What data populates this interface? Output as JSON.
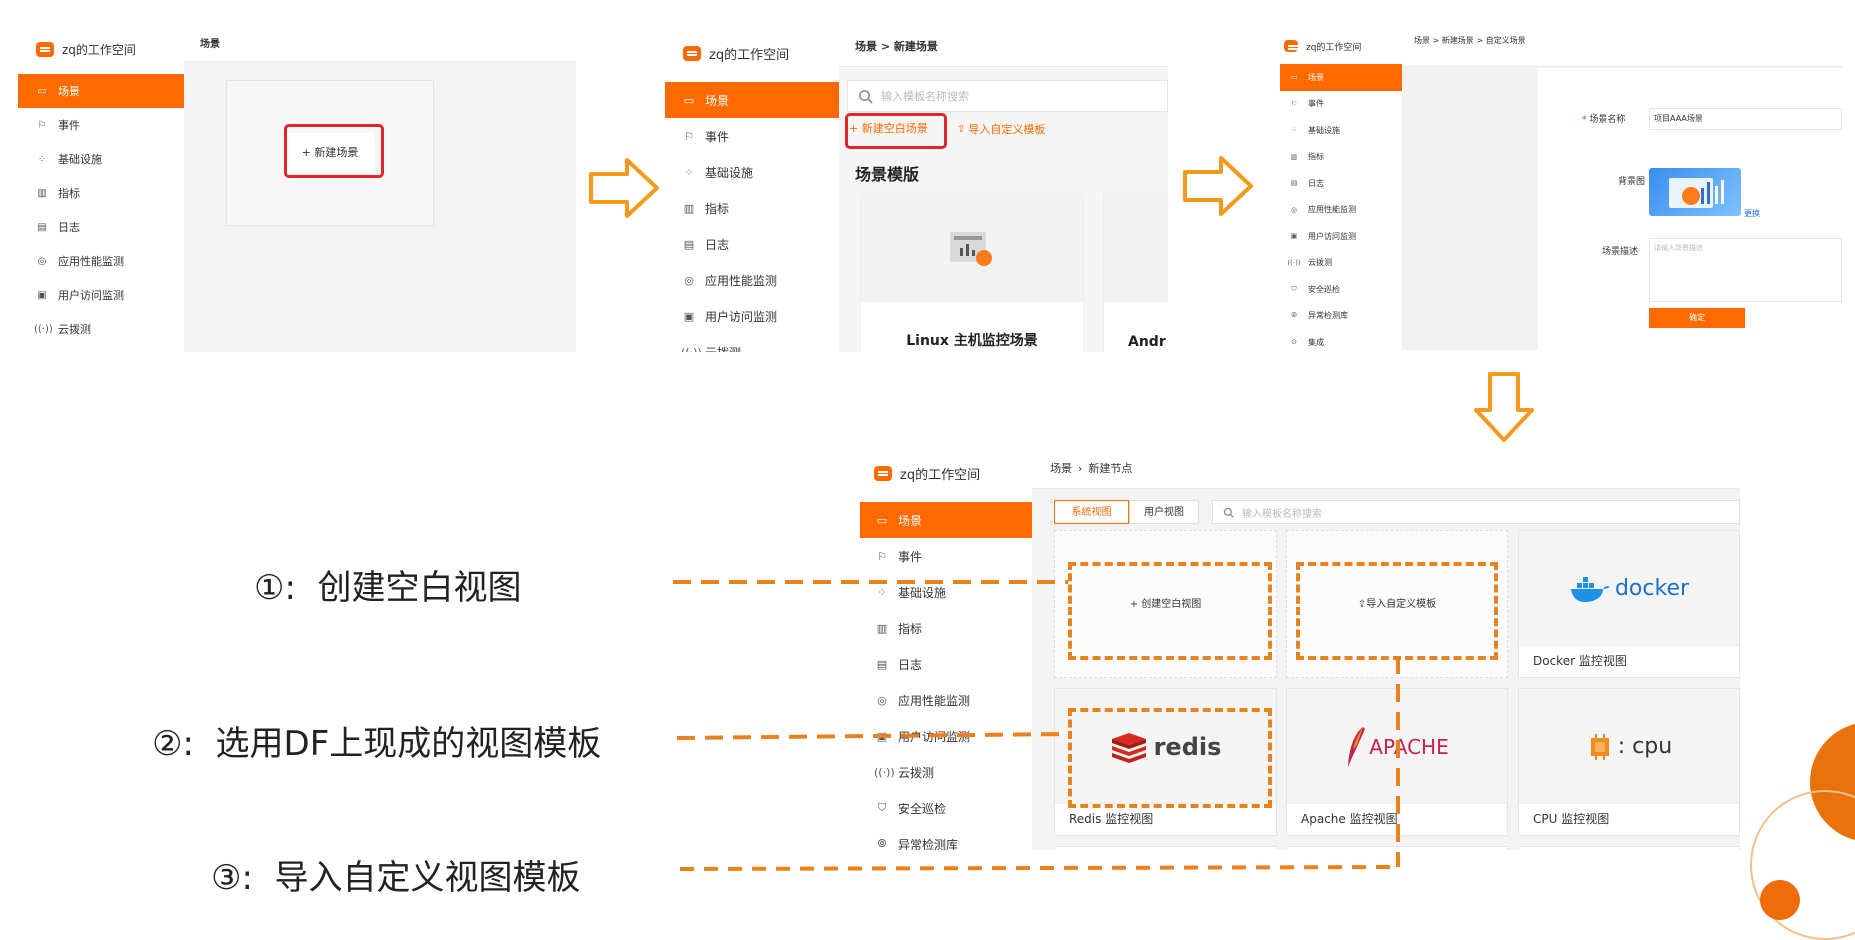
{
  "workspace_name": "zq的工作空间",
  "nav_items": [
    {
      "label": "场景",
      "icon": "dashboard-icon"
    },
    {
      "label": "事件",
      "icon": "flag-icon"
    },
    {
      "label": "基础设施",
      "icon": "grid-icon"
    },
    {
      "label": "指标",
      "icon": "bar-chart-icon"
    },
    {
      "label": "日志",
      "icon": "calendar-icon"
    },
    {
      "label": "应用性能监测",
      "icon": "target-icon"
    },
    {
      "label": "用户访问监测",
      "icon": "monitor-icon"
    },
    {
      "label": "云拨测",
      "icon": "signal-icon"
    },
    {
      "label": "安全巡检",
      "icon": "shield-icon"
    },
    {
      "label": "异常检测库",
      "icon": "detector-icon"
    },
    {
      "label": "集成",
      "icon": "integration-icon"
    }
  ],
  "panel1": {
    "breadcrumb": "场景",
    "new_scene_button": "+ 新建场景"
  },
  "panel2": {
    "breadcrumb": "场景 > 新建场景",
    "search_placeholder": "输入模板名称搜索",
    "new_blank_scene": "+ 新建空白场景",
    "import_template": "导入自定义模板",
    "section_title": "场景模版",
    "card1_title": "Linux 主机监控场景",
    "card2_title_partial": "Andr"
  },
  "panel3": {
    "breadcrumb": "场景 > 新建场景 > 自定义场景",
    "name_label": "场景名称",
    "name_value": "项目AAA场景",
    "bg_label": "背景图",
    "change_link": "更换",
    "desc_label": "场景描述",
    "desc_placeholder": "请输入场景描述",
    "confirm_button": "确定"
  },
  "panel4": {
    "breadcrumb_root": "场景",
    "breadcrumb_current": "新建节点",
    "tab_system": "系统视图",
    "tab_user": "用户视图",
    "search_placeholder": "输入模板名称搜索",
    "create_blank_view": "+ 创建空白视图",
    "import_custom_template": "导入自定义模板",
    "tiles": [
      {
        "logo": "docker",
        "caption": "Docker 监控视图"
      },
      {
        "logo": "redis",
        "caption": "Redis 监控视图"
      },
      {
        "logo": "APACHE",
        "caption": "Apache 监控视图"
      },
      {
        "logo": ": cpu",
        "caption": "CPU 监控视图"
      }
    ]
  },
  "annotations": [
    {
      "label": "①:  创建空白视图"
    },
    {
      "label": "②:  选用DF上现成的视图模板"
    },
    {
      "label": "③:  导入自定义视图模板"
    }
  ],
  "colors": {
    "accent": "#ff6a00",
    "highlight_red": "#e2242b",
    "dash_orange": "#e8821e"
  }
}
